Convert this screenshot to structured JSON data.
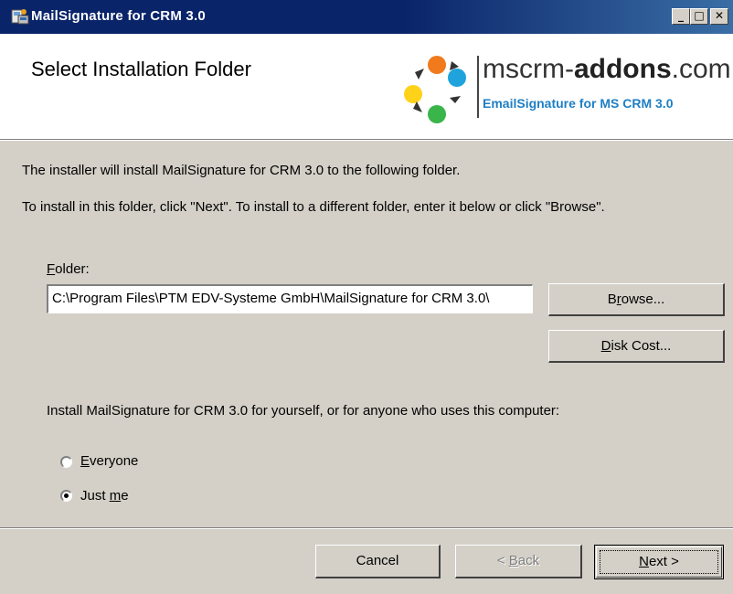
{
  "window": {
    "title": "MailSignature for CRM 3.0",
    "controls": {
      "minimize": "_",
      "maximize": "□",
      "close": "✕"
    }
  },
  "header": {
    "title": "Select Installation Folder",
    "logo": {
      "text_prefix": "mscrm-",
      "text_bold": "addons",
      "text_suffix": ".com",
      "subtitle": "EmailSignature for MS CRM 3.0"
    }
  },
  "body": {
    "intro_line1": "The installer will install MailSignature for CRM 3.0 to the following folder.",
    "intro_line2": "To install in this folder, click \"Next\". To install to a different folder, enter it below or click \"Browse\".",
    "folder_label_mnemonic": "F",
    "folder_label_rest": "older:",
    "folder_value": "C:\\Program Files\\PTM EDV-Systeme GmbH\\MailSignature for CRM 3.0\\",
    "browse_mnemonic": "r",
    "browse_pre": "B",
    "browse_post": "owse...",
    "diskcost_mnemonic": "D",
    "diskcost_post": "isk Cost...",
    "install_for_text": "Install MailSignature for CRM 3.0 for yourself, or for anyone who uses this computer:",
    "radio_everyone_mnemonic": "E",
    "radio_everyone_rest": "veryone",
    "radio_justme_pre": "Just ",
    "radio_justme_mnemonic": "m",
    "radio_justme_post": "e",
    "selected_option": "Just me"
  },
  "footer": {
    "cancel_label": "Cancel",
    "back_pre": "< ",
    "back_mnemonic": "B",
    "back_post": "ack",
    "next_mnemonic": "N",
    "next_post": "ext >"
  },
  "colors": {
    "titlebar": "#0a246a",
    "face": "#d4d0c8",
    "logo_accent": "#1e7fc4"
  }
}
